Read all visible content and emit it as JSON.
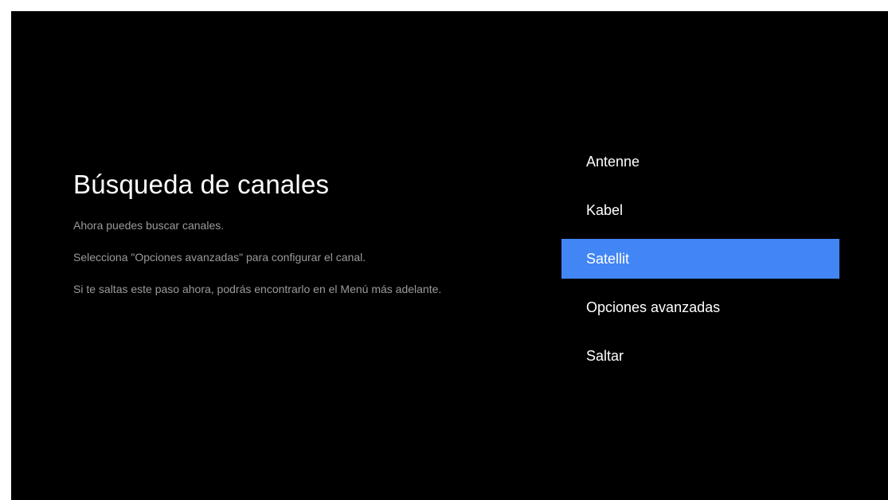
{
  "title": "Búsqueda de canales",
  "descriptions": [
    "Ahora puedes buscar canales.",
    "Selecciona \"Opciones avanzadas\" para configurar el canal.",
    "Si te saltas este paso ahora, podrás encontrarlo en el Menú más adelante."
  ],
  "menu": {
    "items": [
      {
        "label": "Antenne"
      },
      {
        "label": "Kabel"
      },
      {
        "label": "Satellit",
        "selected": true
      },
      {
        "label": "Opciones avanzadas"
      },
      {
        "label": "Saltar"
      }
    ],
    "selected_index": 2,
    "highlight_color": "#4285f4"
  },
  "colors": {
    "background": "#000000",
    "title": "#ffffff",
    "description": "#9a9a9a"
  }
}
